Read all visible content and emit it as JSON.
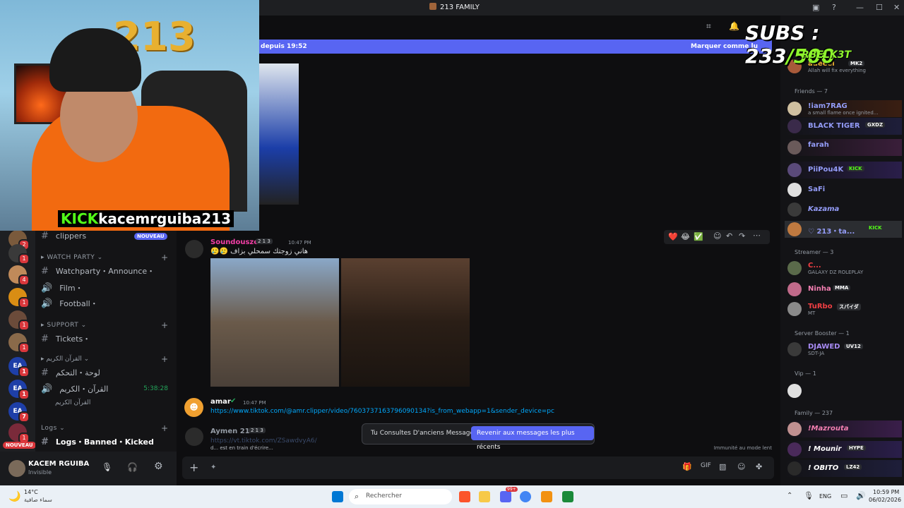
{
  "window": {
    "title": "213 FAMILY"
  },
  "stream_overlay": {
    "subs_label": "SUBS : 233",
    "subs_goal": "/500",
    "top_name": "RBELK3T",
    "platform_label": "KICK",
    "streamer_name": "kacemrguiba213",
    "cam_numbers": "213"
  },
  "banner": {
    "text": "depuis 19:52",
    "action": "Marquer comme lu"
  },
  "channels": {
    "top_channel": "clippers",
    "top_badge": "NOUVEAU",
    "categories": [
      {
        "name": "WATCH PARTY",
        "items": [
          "Watchparty・Announce・",
          "Film・",
          "Football・"
        ]
      },
      {
        "name": "SUPPORT",
        "items": [
          "Tickets・"
        ]
      },
      {
        "name": "القرآن الكريم",
        "items": [
          "لوحة・التحكم",
          "القرآن・الكريم",
          "القرآن الكريم"
        ],
        "voice_time": "5:38:28"
      },
      {
        "name": "Logs",
        "items": [
          "Logs・Banned・Kicked"
        ]
      }
    ],
    "new_badge": "NOUVEAU"
  },
  "user_panel": {
    "name": "KACEM RGUIBA",
    "status": "Invisible"
  },
  "chat": {
    "messages": [
      {
        "author": "Soundouszek",
        "tag": "2 1 3",
        "time": "10:47 PM",
        "text": "هاني زوجتك سمحلي بزاف"
      },
      {
        "author": "amar",
        "time": "10:47 PM",
        "link": "https://www.tiktok.com/@amr.clipper/video/7603737163796090134?is_from_webapp=1&sender_device=pc"
      },
      {
        "author": "Aymen 213",
        "tag": "2 1 3",
        "time": "10:47 PM",
        "link": "https://vt.tiktok.com/ZSawdvyA6/"
      }
    ],
    "typing": "d... est en train d'écrire...",
    "slowmode": "Immunité au mode lent",
    "toast_text": "Tu Consultes D'anciens Messages",
    "toast_button": "Revenir aux messages les plus récents",
    "reactions": [
      "❤️",
      "😂",
      "✅"
    ]
  },
  "members": {
    "groups": [
      {
        "header": "Friends",
        "count": "7"
      },
      {
        "header": "Streamer",
        "count": "3"
      },
      {
        "header": "Server Booster",
        "count": "1"
      },
      {
        "header": "Vip",
        "count": "1"
      },
      {
        "header": "Family",
        "count": "237"
      }
    ],
    "rows": [
      {
        "name": "adeeel",
        "tag": "MK2",
        "sub": "Allah will fix everything",
        "color": "#f0b232"
      },
      {
        "name": "!iam7RAG",
        "sub": "a small flame once ignited...",
        "color": "#949cf7"
      },
      {
        "name": "BLACK TIGER",
        "tag": "GXDZ",
        "color": "#949cf7"
      },
      {
        "name": "farah",
        "color": "#949cf7"
      },
      {
        "name": "PiiPou4K",
        "tag": "KICK",
        "color": "#949cf7"
      },
      {
        "name": "SaFi",
        "color": "#949cf7"
      },
      {
        "name": "Kazama",
        "color": "#949cf7"
      },
      {
        "name": "213・ta...",
        "tag": "KICK",
        "color": "#949cf7"
      },
      {
        "name": "C...",
        "sub": "GALAXY DZ ROLEPLAY",
        "color": "#f23f43"
      },
      {
        "name": "Ninha",
        "tag": "MMA",
        "color": "#f47fb2"
      },
      {
        "name": "TuRbo",
        "tag": "スパイダ",
        "sub": "MT",
        "color": "#f23f43"
      },
      {
        "name": "DJAWED",
        "tag": "UV12",
        "sub": "SDT-JA",
        "color": "#a88bf5"
      },
      {
        "name": "!Mazrouta",
        "color": "#f47fb2"
      },
      {
        "name": "! Mounir",
        "tag": "HYPE",
        "color": "#ffffff"
      },
      {
        "name": "! OBITO",
        "tag": "LZ42",
        "color": "#ffffff"
      }
    ]
  },
  "taskbar": {
    "weather_temp": "14°C",
    "weather_desc": "سماء صافية",
    "search_placeholder": "Rechercher",
    "lang": "ENG",
    "time": "10:59 PM",
    "date": "06/02/2026",
    "notif_count": "99+"
  },
  "colors": {
    "accent": "#5865f2",
    "kick_green": "#53fc18"
  }
}
